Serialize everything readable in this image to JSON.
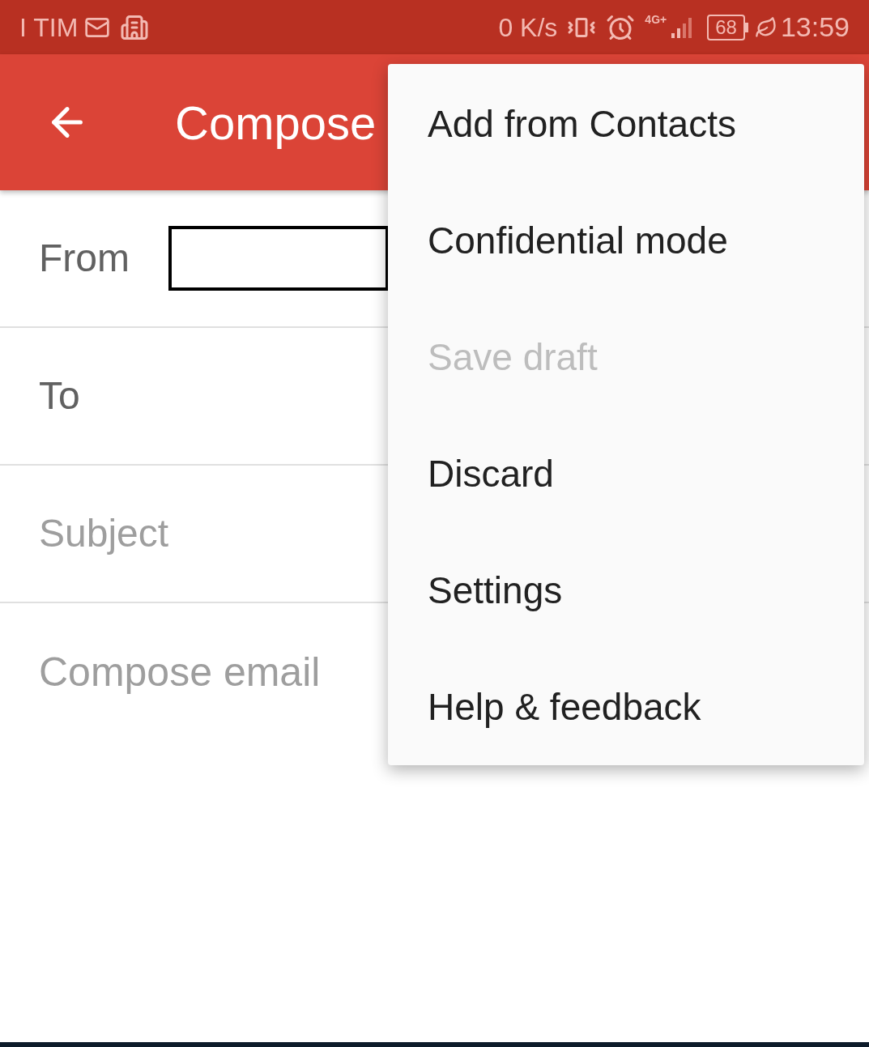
{
  "status_bar": {
    "carrier": "I TIM",
    "speed": "0 K/s",
    "network": "4G+",
    "battery": "68",
    "time": "13:59"
  },
  "toolbar": {
    "title": "Compose"
  },
  "fields": [
    {
      "kind": "label",
      "text": "From"
    },
    {
      "kind": "label",
      "text": "To"
    },
    {
      "kind": "input",
      "placeholder": "Subject"
    }
  ],
  "body": {
    "placeholder": "Compose email"
  },
  "menu": [
    {
      "label": "Add from Contacts",
      "disabled": false
    },
    {
      "label": "Confidential mode",
      "disabled": false
    },
    {
      "label": "Save draft",
      "disabled": true
    },
    {
      "label": "Discard",
      "disabled": false
    },
    {
      "label": "Settings",
      "disabled": false
    },
    {
      "label": "Help & feedback",
      "disabled": false
    }
  ]
}
